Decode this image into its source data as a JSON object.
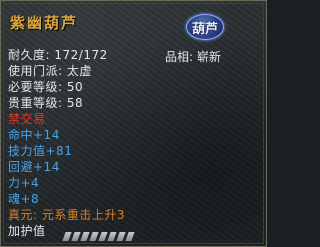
{
  "item": {
    "name": "紫幽葫芦",
    "icon_label": "葫芦",
    "durability_label": "耐久度:",
    "durability_value": "172/172",
    "grade_label": "品相:",
    "grade_value": "崭新",
    "sect_label": "使用门派:",
    "sect_value": "太虚",
    "req_level_label": "必要等级:",
    "req_level_value": "50",
    "honor_level_label": "贵重等级:",
    "honor_level_value": "58",
    "trade_status": "禁交易",
    "stats": [
      "命中+14",
      "技力值+81",
      "回避+14",
      "力+4",
      "魂+8"
    ],
    "true_yuan": "真元: 元系重击上升3",
    "protect_label": "加护值",
    "protect_segments": 8
  },
  "colors": {
    "title": "#d8a53a",
    "white": "#e6e6e6",
    "red": "#e23a2b",
    "blue": "#4aa3e8",
    "orange": "#e07b1f"
  }
}
